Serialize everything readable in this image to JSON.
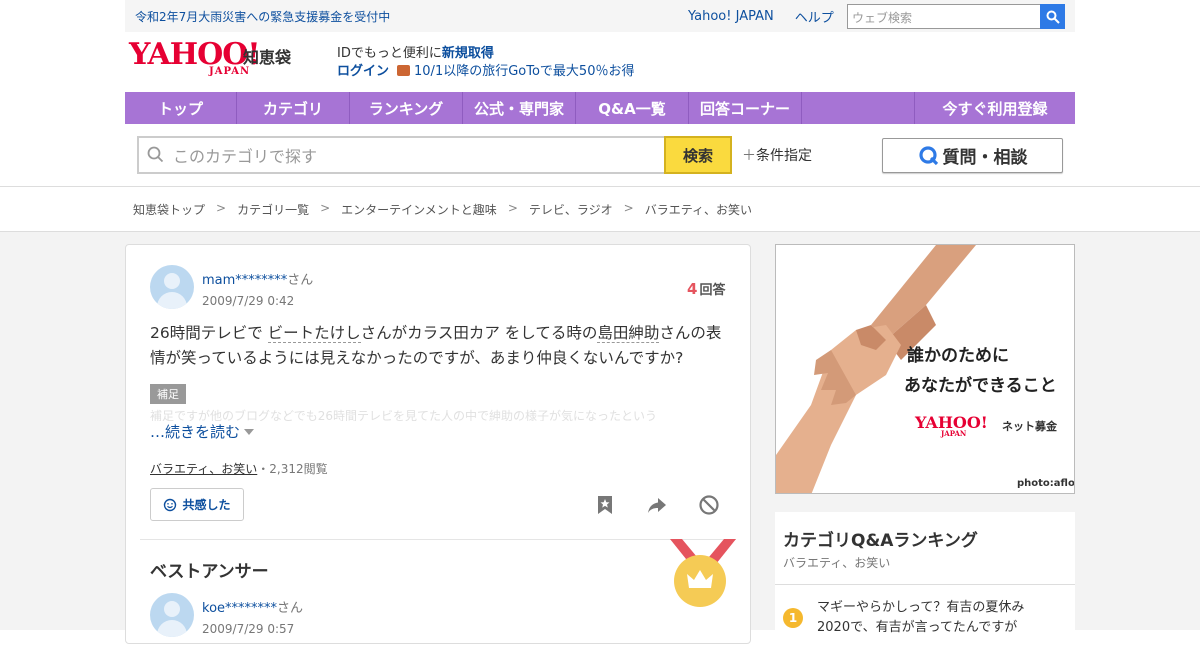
{
  "topbar": {
    "notice": "令和2年7月大雨災害への緊急支援募金を受付中",
    "link_yahoo": "Yahoo! JAPAN",
    "link_help": "ヘルプ",
    "search_placeholder": "ウェブ検索"
  },
  "header": {
    "logo_main": "YAHOO!",
    "logo_sub": "JAPAN",
    "service_name": "知恵袋",
    "promo_text": "IDでもっと便利に",
    "signup_link": "新規取得",
    "login_link": "ログイン",
    "goto_promo": "10/1以降の旅行GoToで最大50％お得"
  },
  "nav": {
    "items": [
      "トップ",
      "カテゴリ",
      "ランキング",
      "公式・専門家",
      "Q&A一覧",
      "回答コーナー"
    ],
    "register": "今すぐ利用登録"
  },
  "search": {
    "placeholder": "このカテゴリで探す",
    "button": "検索",
    "conditions": "条件指定",
    "ask_button": "質問・相談"
  },
  "breadcrumb": [
    "知恵袋トップ",
    "カテゴリ一覧",
    "エンターテインメントと趣味",
    "テレビ、ラジオ",
    "バラエティ、お笑い"
  ],
  "breadcrumb_sep": ">",
  "question": {
    "user": "mam********",
    "san": "さん",
    "date": "2009/7/29 0:42",
    "answer_count": "4",
    "answer_label": "回答",
    "text_part1": "26時間テレビで ",
    "link1": "ビートたけし",
    "text_part2": "さんがカラス田カア をしてる時の",
    "link2": "島田紳助",
    "text_part3": "さんの表情が笑っているようには見えなかったのですが、あまり仲良くないんですか?",
    "supplement_label": "補足",
    "supplement_text": "補足ですが他のブログなどでも26時間テレビを見てた人の中で紳助の様子が気になったという",
    "read_more": "…続きを読む",
    "category": "バラエティ、お笑い",
    "views": "・2,312閲覧",
    "empathy": "共感した"
  },
  "best_answer": {
    "heading": "ベストアンサー",
    "user": "koe********",
    "san": "さん",
    "date": "2009/7/29 0:57"
  },
  "ad": {
    "line1": "誰かのために",
    "line2": "あなたができること",
    "brand": "YAHOO!",
    "brand_sub": "JAPAN",
    "service": "ネット募金",
    "credit": "photo:aflo"
  },
  "ranking": {
    "title": "カテゴリQ&Aランキング",
    "subtitle": "バラエティ、お笑い",
    "items": [
      {
        "num": "1",
        "text": "マギーやらかしって？有吉の夏休み2020で、有吉が言ってたんですが"
      }
    ]
  },
  "colors": {
    "nav": "#a774d5",
    "link": "#0d4f9e",
    "search_button": "#fada3e",
    "answer_count": "#e5545e",
    "yahoo_red": "#e60033"
  }
}
